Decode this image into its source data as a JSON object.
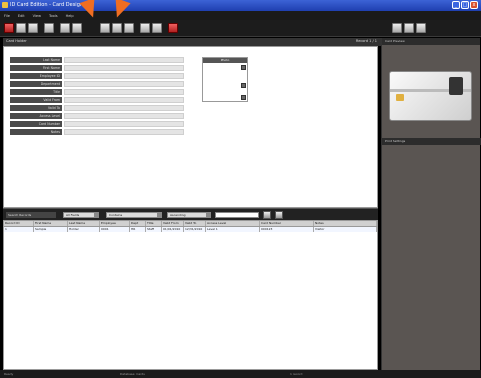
{
  "window": {
    "title": "ID Card Edition - Card Designer"
  },
  "menubar": {
    "items": [
      "File",
      "Edit",
      "View",
      "Tools",
      "Help"
    ]
  },
  "subheader": {
    "left": "Card Holder",
    "right": "Record 1 / 1"
  },
  "form": {
    "fields": [
      {
        "label": "Last Name"
      },
      {
        "label": "First Name"
      },
      {
        "label": "Employee ID"
      },
      {
        "label": "Department"
      },
      {
        "label": "Title"
      },
      {
        "label": "Valid From"
      },
      {
        "label": "Valid To"
      },
      {
        "label": "Access Level"
      },
      {
        "label": "Card Number"
      },
      {
        "label": "Notes"
      }
    ],
    "photo_label": "Photo"
  },
  "filter": {
    "label": "Search Records",
    "combo1": "All Fields",
    "combo2": "Contains",
    "combo3": "Ascending"
  },
  "grid": {
    "columns": [
      "Record ID",
      "First Name",
      "Last Name",
      "Employee",
      "Dept",
      "Title",
      "Valid From",
      "Valid To",
      "Access Level",
      "Card Number",
      "Notes"
    ],
    "rows": [
      [
        "1",
        "Sample",
        "Holder",
        "0001",
        "HR",
        "Staff",
        "01/01/2010",
        "12/31/2010",
        "Level 1",
        "000123",
        "Visitor"
      ]
    ]
  },
  "rightpanel": {
    "header": "Card Preview",
    "header2": "Print Settings"
  },
  "statusbar": {
    "left": "Ready",
    "middle": "Database: Cards",
    "right": "1 record"
  },
  "colors": {
    "arrow": "#f06d22",
    "titlebar": "#1f3fb0"
  }
}
